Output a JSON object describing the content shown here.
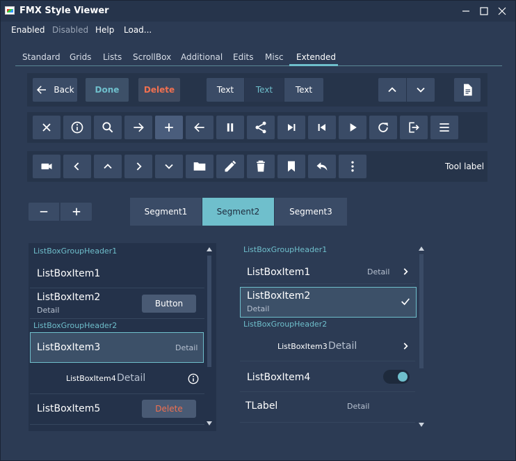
{
  "window": {
    "title": "FMX Style Viewer"
  },
  "menu": [
    {
      "label": "Enabled",
      "disabled": false
    },
    {
      "label": "Disabled",
      "disabled": true
    },
    {
      "label": "Help",
      "disabled": false
    },
    {
      "label": "Load...",
      "disabled": false
    }
  ],
  "tabs": [
    {
      "label": "Standard",
      "active": false
    },
    {
      "label": "Grids",
      "active": false
    },
    {
      "label": "Lists",
      "active": false
    },
    {
      "label": "ScrollBox",
      "active": false
    },
    {
      "label": "Additional",
      "active": false
    },
    {
      "label": "Edits",
      "active": false
    },
    {
      "label": "Misc",
      "active": false
    },
    {
      "label": "Extended",
      "active": true
    }
  ],
  "toolbar1": {
    "back_label": "Back",
    "done_label": "Done",
    "delete_label": "Delete",
    "text_buttons": [
      "Text",
      "Text",
      "Text"
    ]
  },
  "toolbar2_icons": [
    "close-icon",
    "info-icon",
    "search-icon",
    "arrow-right-icon",
    "plus-icon",
    "arrow-left-icon",
    "pause-icon",
    "share-icon",
    "skip-next-icon",
    "skip-previous-icon",
    "play-icon",
    "refresh-icon",
    "exit-icon",
    "menu-icon"
  ],
  "toolbar3": {
    "icons": [
      "camera-icon",
      "chevron-left-icon",
      "chevron-up-icon",
      "chevron-right-icon",
      "chevron-down-icon",
      "folder-icon",
      "pencil-icon",
      "trash-icon",
      "bookmark-icon",
      "reply-icon",
      "more-vertical-icon"
    ],
    "tool_label": "Tool label"
  },
  "segments": [
    "Segment1",
    "Segment2",
    "Segment3"
  ],
  "listbox_left": {
    "group1": "ListBoxGroupHeader1",
    "item1": "ListBoxItem1",
    "item2": "ListBoxItem2",
    "item2_detail": "Detail",
    "item2_button": "Button",
    "group2": "ListBoxGroupHeader2",
    "item3": "ListBoxItem3",
    "item3_detail": "Detail",
    "item4": "ListBoxItem4",
    "item4_detail": "Detail",
    "item5": "ListBoxItem5",
    "item5_button": "Delete"
  },
  "listbox_right": {
    "group1": "ListBoxGroupHeader1",
    "item1": "ListBoxItem1",
    "item1_detail": "Detail",
    "item2": "ListBoxItem2",
    "item2_detail": "Detail",
    "group2": "ListBoxGroupHeader2",
    "item3": "ListBoxItem3",
    "item3_detail": "Detail",
    "item4": "ListBoxItem4",
    "item5": "TLabel",
    "item5_detail": "Detail"
  },
  "colors": {
    "accent": "#6fbfcc",
    "delete": "#f07050",
    "background": "#2c3b54"
  }
}
